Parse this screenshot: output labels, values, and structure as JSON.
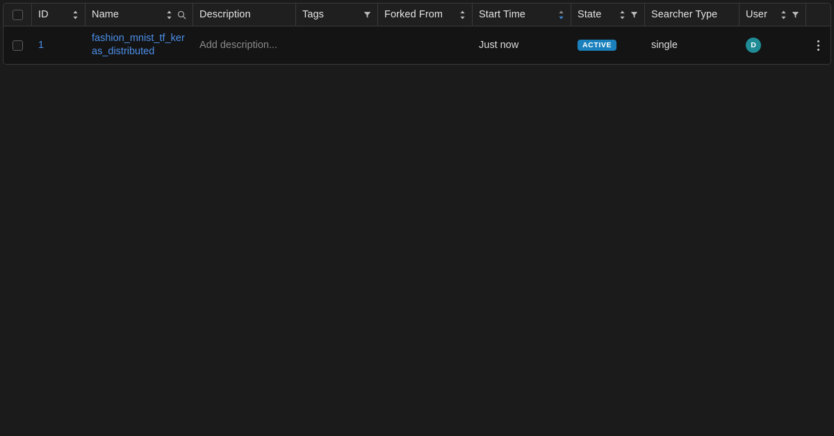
{
  "table": {
    "columns": [
      {
        "key": "select",
        "label": "",
        "width": 41,
        "sortable": false,
        "filterable": false,
        "searchable": false
      },
      {
        "key": "id",
        "label": "ID",
        "width": 77,
        "sortable": true,
        "filterable": false,
        "searchable": false
      },
      {
        "key": "name",
        "label": "Name",
        "width": 155,
        "sortable": true,
        "filterable": false,
        "searchable": true
      },
      {
        "key": "description",
        "label": "Description",
        "width": 148,
        "sortable": false,
        "filterable": false,
        "searchable": false
      },
      {
        "key": "tags",
        "label": "Tags",
        "width": 118,
        "sortable": false,
        "filterable": true,
        "searchable": false
      },
      {
        "key": "forked_from",
        "label": "Forked From",
        "width": 136,
        "sortable": true,
        "filterable": false,
        "searchable": false
      },
      {
        "key": "start_time",
        "label": "Start Time",
        "width": 142,
        "sortable": true,
        "filterable": false,
        "searchable": false,
        "sort_active": "desc"
      },
      {
        "key": "state",
        "label": "State",
        "width": 106,
        "sortable": true,
        "filterable": true,
        "searchable": false
      },
      {
        "key": "searcher_type",
        "label": "Searcher Type",
        "width": 136,
        "sortable": false,
        "filterable": false,
        "searchable": false
      },
      {
        "key": "user",
        "label": "User",
        "width": 96,
        "sortable": true,
        "filterable": true,
        "searchable": false
      },
      {
        "key": "actions",
        "label": "",
        "width": 35,
        "sortable": false,
        "filterable": false,
        "searchable": false
      }
    ],
    "rows": [
      {
        "selected": false,
        "id": "1",
        "name": "fashion_mnist_tf_keras_distributed",
        "description": "",
        "description_placeholder": "Add description...",
        "tags": "",
        "forked_from": "",
        "start_time": "Just now",
        "state": "ACTIVE",
        "searcher_type": "single",
        "user_initial": "D",
        "actions_label": "More actions"
      }
    ],
    "header_select_all_checked": false
  },
  "icons": {
    "sort": "sort-icon",
    "filter": "filter-icon",
    "search": "search-icon",
    "kebab": "more-vertical-icon",
    "checkbox": "checkbox-icon"
  },
  "colors": {
    "page_background": "#1b1b1b",
    "table_background": "#141414",
    "header_background": "#1f1f1f",
    "border": "#3a3a3a",
    "link": "#4c8fe8",
    "badge_active": "#1b81bd",
    "avatar": "#1f8c96",
    "sort_active": "#3b8ede",
    "text_primary": "#dcdcdc",
    "text_muted": "#8a8a8a"
  }
}
